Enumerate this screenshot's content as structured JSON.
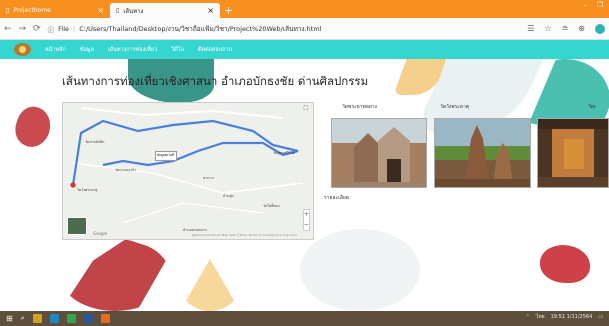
{
  "browser": {
    "tabs": [
      {
        "title": "Projecthome",
        "active": false
      },
      {
        "title": "เส้นทาง",
        "active": true
      }
    ],
    "new_tab": "+",
    "window_controls": [
      "–",
      "❐"
    ],
    "url_prefix": "File",
    "url": "C:/Users/Thailand/Desktop/งาน/วิชาถือแฟ้ม/วิชา/Project%20Web/เส้นทาง.html",
    "icons": [
      "bookmark-icon",
      "favorites-icon",
      "collections-icon",
      "profile-icon"
    ]
  },
  "site_nav": {
    "items": [
      "หน้าหลัก",
      "ข้อมูล",
      "เส้นทางการท่องเที่ยว",
      "วิดีโอ",
      "ติดต่อสอบถาม"
    ]
  },
  "page": {
    "heading": "เส้นทางการท่องเที่ยวเชิงศาสนา อำเภอบักธงชัย ด่านศิลปกรรม"
  },
  "map": {
    "labels": [
      "วัดป่าหลักสิบ",
      "วัดพุทธศรีนิมิต",
      "วัดป่าหนองบัว",
      "วัดวังพระธาตุ",
      "ตาเกาะ",
      "บ้านทุ่ง",
      "วัดโพธิ์ทอง",
      "ตำบลสวนหมาก"
    ],
    "popup": "ข้อมูลสถานที่",
    "google": "Google",
    "copyright": "Keyboard shortcuts  Map data ©2021  Terms of Use  Report a map error"
  },
  "gallery": {
    "captions": [
      "วัดพระยาพลยาง",
      "วัดวังพระธาตุ",
      "วัดเ"
    ],
    "detail_label": "รายละเอียด"
  },
  "taskbar": {
    "tray_text": "ไทย",
    "time": "19:51",
    "date": "1/11/2564"
  },
  "colors": {
    "tabstrip": "#f7901e",
    "sitenav": "#35d6d0",
    "route": "#4a7fdb",
    "taskbar": "#5d4f3c"
  }
}
